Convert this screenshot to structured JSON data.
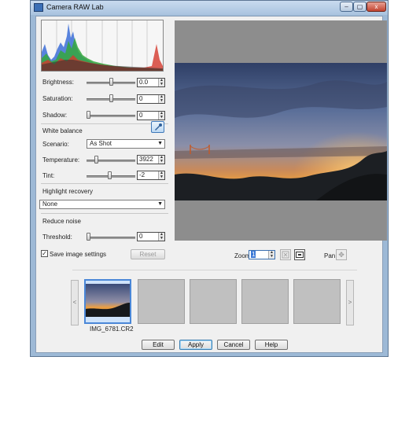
{
  "window": {
    "title": "Camera RAW Lab",
    "minimize": "–",
    "maximize": "▢",
    "close": "x"
  },
  "adjust": {
    "brightness": {
      "label": "Brightness:",
      "value": "0.0",
      "level": 0.5
    },
    "saturation": {
      "label": "Saturation:",
      "value": "0",
      "level": 0.5
    },
    "shadow": {
      "label": "Shadow:",
      "value": "0",
      "level": 0.0
    }
  },
  "white_balance": {
    "title": "White balance",
    "scenario_label": "Scenario:",
    "scenario_value": "As Shot",
    "temperature": {
      "label": "Temperature:",
      "value": "3922",
      "level": 0.18
    },
    "tint": {
      "label": "Tint:",
      "value": "-2",
      "level": 0.48
    }
  },
  "highlight": {
    "title": "Highlight recovery",
    "value": "None"
  },
  "noise": {
    "title": "Reduce noise",
    "threshold_label": "Threshold:",
    "threshold_value": "0",
    "level": 0.0
  },
  "save_settings": {
    "label": "Save image settings",
    "checked": true
  },
  "reset_label": "Reset",
  "zoom": {
    "label": "Zoom:",
    "value": "1"
  },
  "pan": {
    "label": "Pan:"
  },
  "thumbnails": {
    "items": [
      {
        "caption": "IMG_6781.CR2",
        "selected": true
      },
      {
        "caption": ""
      },
      {
        "caption": ""
      },
      {
        "caption": ""
      },
      {
        "caption": ""
      }
    ],
    "prev": "<",
    "next": ">"
  },
  "actions": {
    "edit": "Edit",
    "apply": "Apply",
    "cancel": "Cancel",
    "help": "Help"
  },
  "icons": {
    "wb_picker": "eyedropper-icon",
    "fit": "fit-window-icon",
    "actual": "actual-size-icon",
    "pan": "pan-move-icon"
  },
  "colors": {
    "selection": "#4a87d8",
    "preview_bg": "#8d8d8d"
  }
}
